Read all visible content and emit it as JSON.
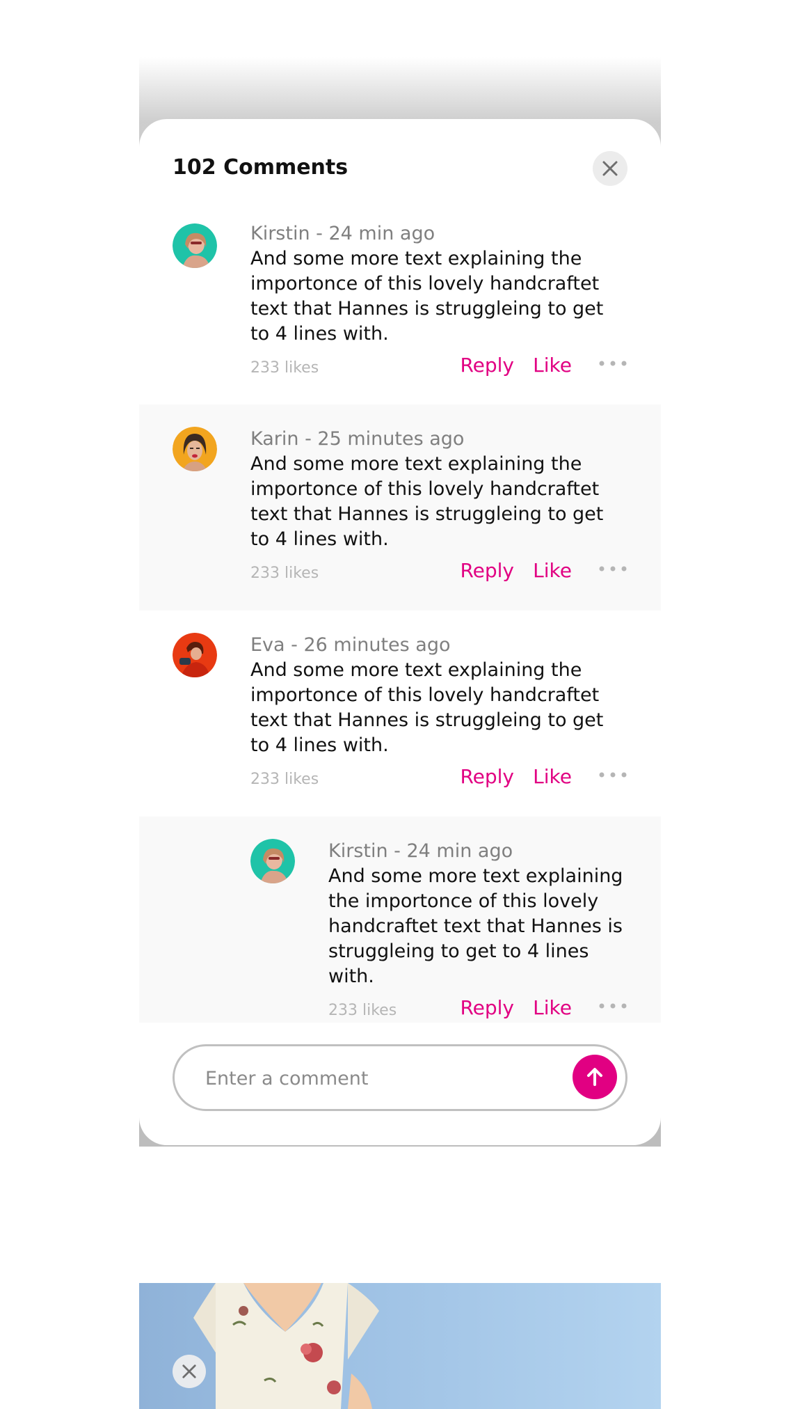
{
  "sheet": {
    "title": "102 Comments"
  },
  "comments": [
    {
      "author": "Kirstin",
      "meta": "Kirstin - 24 min ago",
      "text": "And some more text explaining the importonce of this lovely handcraftet text that Hannes is struggleing to get to 4 lines with.",
      "likes": "233 likes",
      "reply_label": "Reply",
      "like_label": "Like",
      "avatar_color": "#1fc3a8"
    },
    {
      "author": "Karin",
      "meta": "Karin - 25 minutes ago",
      "text": "And some more text explaining the importonce of this lovely handcraftet text that Hannes is struggleing to get to 4 lines with.",
      "likes": "233 likes",
      "reply_label": "Reply",
      "like_label": "Like",
      "avatar_color": "#f2a51f"
    },
    {
      "author": "Eva",
      "meta": "Eva - 26 minutes ago",
      "text": "And some more text explaining the importonce of this lovely handcraftet text that Hannes is struggleing to get to 4 lines with.",
      "likes": "233 likes",
      "reply_label": "Reply",
      "like_label": "Like",
      "avatar_color": "#e83a12"
    }
  ],
  "reply": {
    "author": "Kirstin",
    "meta": "Kirstin - 24 min ago",
    "text": "And some more text explaining the importonce of this lovely handcraftet text that Hannes is struggleing to get to 4 lines with.",
    "likes": "233 likes",
    "reply_label": "Reply",
    "like_label": "Like",
    "avatar_color": "#1fc3a8"
  },
  "composer": {
    "placeholder": "Enter a comment"
  },
  "colors": {
    "accent": "#e10082",
    "meta_text": "#7f7f7f",
    "likes_text": "#b5b5b5",
    "shaded_row": "#f9f9f9"
  },
  "icons": {
    "close": "close-icon",
    "more": "more-dots-icon",
    "send": "arrow-up-icon"
  }
}
